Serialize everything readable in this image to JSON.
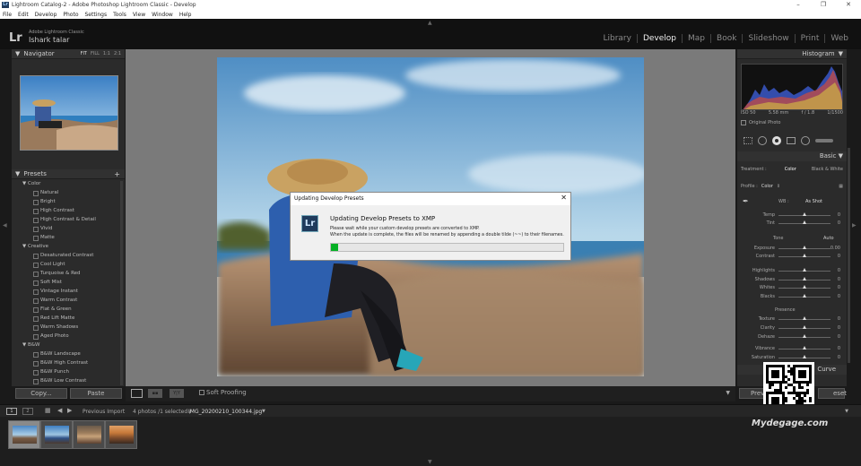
{
  "window": {
    "title": "Lightroom Catalog-2 - Adobe Photoshop Lightroom Classic - Develop",
    "controls": [
      "–",
      "❐",
      "✕"
    ]
  },
  "menu": [
    "File",
    "Edit",
    "Develop",
    "Photo",
    "Settings",
    "Tools",
    "View",
    "Window",
    "Help"
  ],
  "identity": {
    "logo": "Lr",
    "app_name": "Adobe Lightroom Classic",
    "user": "Ishark talar"
  },
  "modules": [
    {
      "label": "Library",
      "active": false
    },
    {
      "label": "Develop",
      "active": true
    },
    {
      "label": "Map",
      "active": false
    },
    {
      "label": "Book",
      "active": false
    },
    {
      "label": "Slideshow",
      "active": false
    },
    {
      "label": "Print",
      "active": false
    },
    {
      "label": "Web",
      "active": false
    }
  ],
  "navigator": {
    "title": "Navigator",
    "zoom": [
      "FIT",
      "FILL",
      "1:1",
      "2:1"
    ]
  },
  "presets": {
    "title": "Presets",
    "add": "+",
    "groups": [
      {
        "name": "Color",
        "items": [
          "Natural",
          "Bright",
          "High Contrast",
          "High Contrast & Detail",
          "Vivid",
          "Matte"
        ]
      },
      {
        "name": "Creative",
        "items": [
          "Desaturated Contrast",
          "Cool Light",
          "Turquoise & Red",
          "Soft Mist",
          "Vintage Instant",
          "Warm Contrast",
          "Flat & Green",
          "Red Lift Matte",
          "Warm Shadows",
          "Aged Photo"
        ]
      },
      {
        "name": "B&W",
        "items": [
          "B&W Landscape",
          "B&W High Contrast",
          "B&W Punch",
          "B&W Low Contrast"
        ]
      }
    ]
  },
  "left_buttons": {
    "copy": "Copy...",
    "paste": "Paste"
  },
  "toolbar": {
    "soft_proofing": "Soft Proofing",
    "yy": "Y|Y"
  },
  "dialog": {
    "title": "Updating Develop Presets",
    "close": "✕",
    "icon": "Lr",
    "heading": "Updating Develop Presets to XMP",
    "line1": "Please wait while your custom develop presets are converted to XMP.",
    "line2": "When the update is complete, the files will be renamed by appending a double tilde (~~) to their filenames.",
    "progress_fraction": 0.03
  },
  "histogram": {
    "title": "Histogram",
    "iso": "ISO 50",
    "focal": "5.58 mm",
    "aperture": "f / 1.8",
    "shutter": "1/1500",
    "original_photo": "Original Photo"
  },
  "basic": {
    "title": "Basic",
    "treatment_label": "Treatment :",
    "treatment_options": [
      "Color",
      "Black & White"
    ],
    "profile_label": "Profile :",
    "profile_value": "Color",
    "wb_label": "WB :",
    "wb_value": "As Shot",
    "tone_label": "Tone",
    "tone_auto": "Auto",
    "presence_label": "Presence",
    "sliders": [
      {
        "label": "Temp",
        "value": "0",
        "pos": 0.5
      },
      {
        "label": "Tint",
        "value": "0",
        "pos": 0.5
      },
      {
        "label": "Exposure",
        "value": "0.00",
        "pos": 0.5
      },
      {
        "label": "Contrast",
        "value": "0",
        "pos": 0.5
      },
      {
        "label": "Highlights",
        "value": "0",
        "pos": 0.5
      },
      {
        "label": "Shadows",
        "value": "0",
        "pos": 0.5
      },
      {
        "label": "Whites",
        "value": "0",
        "pos": 0.5
      },
      {
        "label": "Blacks",
        "value": "0",
        "pos": 0.5
      },
      {
        "label": "Texture",
        "value": "0",
        "pos": 0.5
      },
      {
        "label": "Clarity",
        "value": "0",
        "pos": 0.5
      },
      {
        "label": "Dehaze",
        "value": "0",
        "pos": 0.5
      },
      {
        "label": "Vibrance",
        "value": "0",
        "pos": 0.5
      },
      {
        "label": "Saturation",
        "value": "0",
        "pos": 0.5
      }
    ],
    "curve_label": "Curve",
    "prev_btn": "Previ",
    "reset_btn": "eset"
  },
  "filmstrip": {
    "screens": [
      "1",
      "2"
    ],
    "source": "Previous Import",
    "info": "4 photos /1 selected /",
    "filename": "IMG_20200210_100344.jpg",
    "filter": "Filter :",
    "thumbs": 4
  },
  "watermark": "Mydegage.com"
}
